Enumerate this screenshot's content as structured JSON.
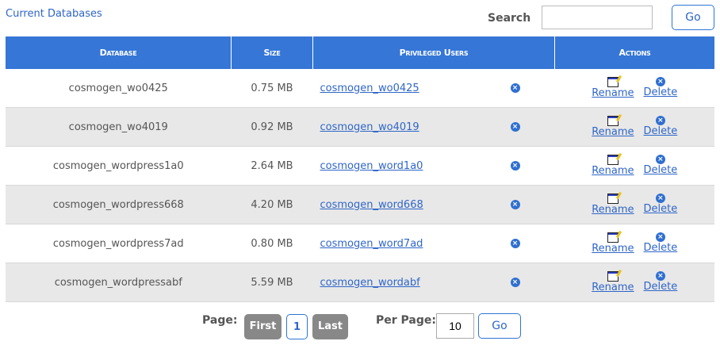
{
  "title": "Current Databases",
  "search": {
    "label": "Search",
    "value": "",
    "go": "Go"
  },
  "headers": [
    "Database",
    "Size",
    "Privileged Users",
    "Actions"
  ],
  "rows": [
    {
      "db": "cosmogen_wo0425",
      "size": "0.75 MB",
      "user": "cosmogen_wo0425"
    },
    {
      "db": "cosmogen_wo4019",
      "size": "0.92 MB",
      "user": "cosmogen_wo4019"
    },
    {
      "db": "cosmogen_wordpress1a0",
      "size": "2.64 MB",
      "user": "cosmogen_word1a0"
    },
    {
      "db": "cosmogen_wordpress668",
      "size": "4.20 MB",
      "user": "cosmogen_word668"
    },
    {
      "db": "cosmogen_wordpress7ad",
      "size": "0.80 MB",
      "user": "cosmogen_word7ad"
    },
    {
      "db": "cosmogen_wordpressabf",
      "size": "5.59 MB",
      "user": "cosmogen_wordabf"
    }
  ],
  "actions": {
    "rename": "Rename",
    "delete": "Delete"
  },
  "pager": {
    "label": "Page:",
    "first": "First",
    "current": "1",
    "last": "Last",
    "per_page_label": "Per Page:",
    "per_page": "10",
    "go": "Go"
  }
}
